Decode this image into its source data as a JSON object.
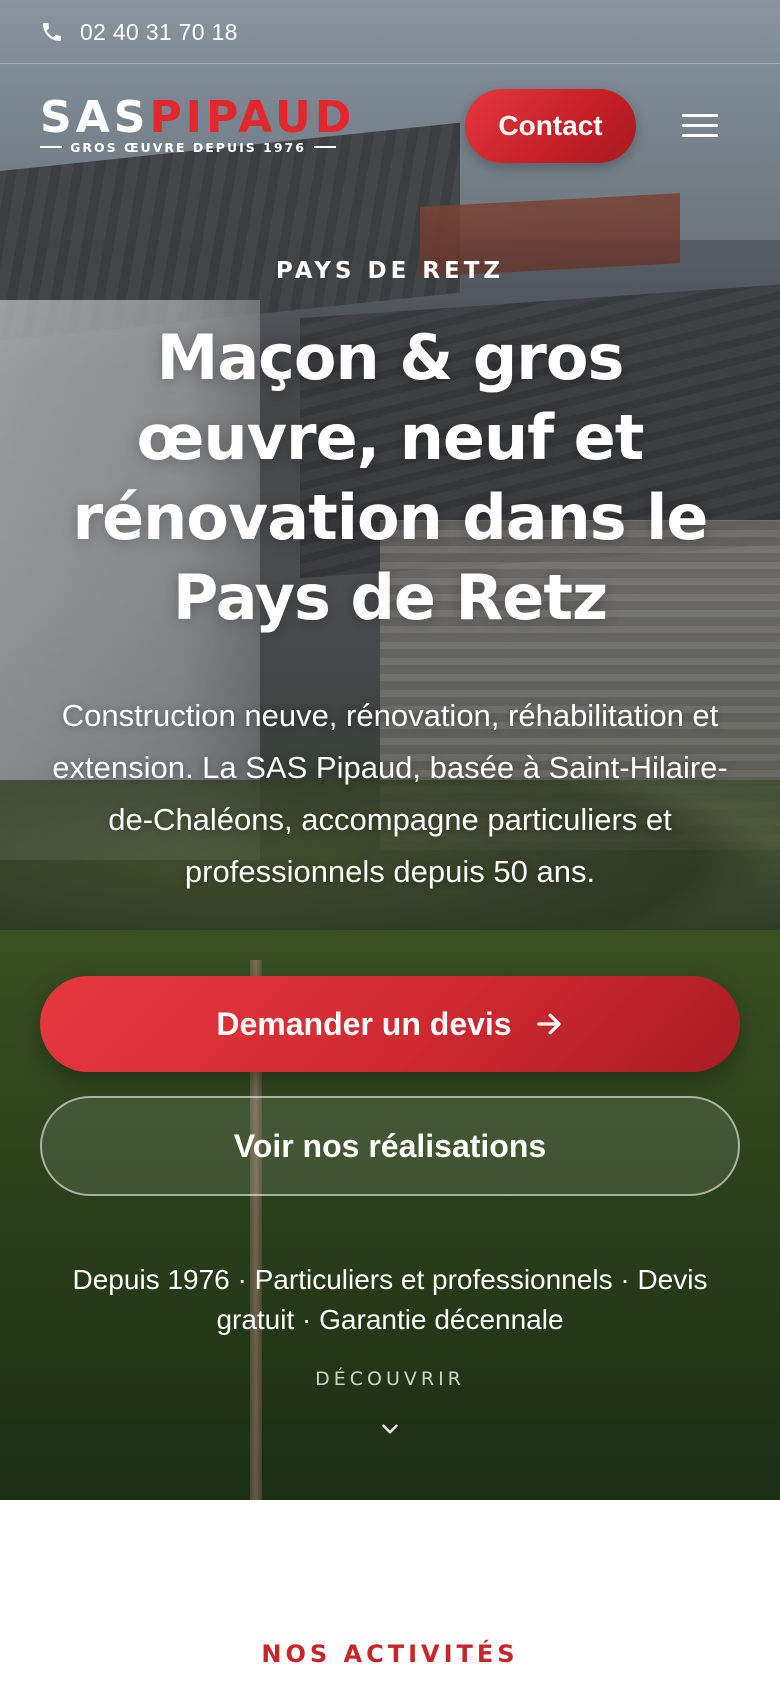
{
  "topbar": {
    "phone_icon": "phone-icon",
    "phone": "02 40 31 70 18"
  },
  "header": {
    "logo": {
      "part1": "SAS",
      "part2": "PIPAUD",
      "tagline": "GROS ŒUVRE DEPUIS 1976"
    },
    "contact_label": "Contact",
    "menu_icon": "hamburger-menu-icon"
  },
  "hero": {
    "eyebrow": "PAYS DE RETZ",
    "title": "Maçon & gros œuvre, neuf et rénovation dans le Pays de Retz",
    "description": "Construction neuve, rénovation, réhabilitation et extension. La SAS Pipaud, basée à Saint-Hilaire-de-Chaléons, accompagne particuliers et professionnels depuis 50 ans.",
    "cta_primary": "Demander un devis",
    "cta_primary_icon": "arrow-right-icon",
    "cta_secondary": "Voir nos réalisations",
    "trust_line": "Depuis 1976 · Particuliers et professionnels · Devis gratuit · Garantie décennale",
    "discover": "DÉCOUVRIR",
    "discover_icon": "chevron-down-icon"
  },
  "next_section": {
    "eyebrow": "NOS ACTIVITÉS"
  },
  "colors": {
    "brand_red": "#d2262c",
    "white": "#ffffff"
  }
}
